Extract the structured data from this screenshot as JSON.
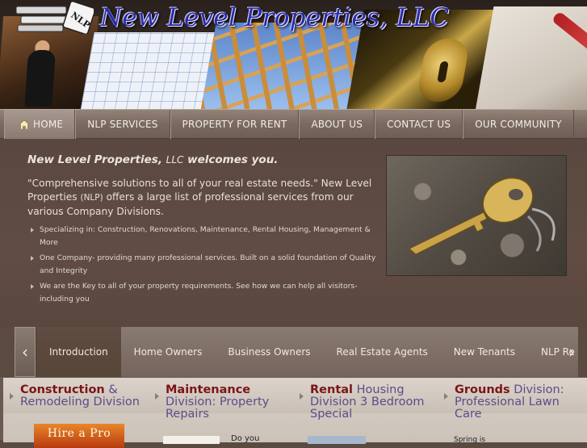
{
  "header": {
    "site_title": "New Level Properties, LLC",
    "logo_text": "NLP"
  },
  "nav": {
    "items": [
      {
        "label": "HOME",
        "icon": "home-icon"
      },
      {
        "label": "NLP SERVICES"
      },
      {
        "label": "PROPERTY FOR RENT"
      },
      {
        "label": "ABOUT US"
      },
      {
        "label": "CONTACT US"
      },
      {
        "label": "OUR COMMUNITY"
      }
    ]
  },
  "main": {
    "welcome_company": "New Level Properties,",
    "welcome_llc": "LLC",
    "welcome_tail": "welcomes you.",
    "intro_part1": "\"Comprehensive solutions to all of your real estate needs.\" New Level Properties",
    "intro_nlp": "(NLP)",
    "intro_part2": "offers a large list of professional services from our various Company Divisions.",
    "bullets": [
      "Specializing in: Construction, Renovations, Maintenance, Rental Housing, Management & More",
      "One Company- providing many professional services.  Built on a solid foundation of Quality and Integrity",
      "We are the Key to all of your property requirements.  See how we can help all visitors- including you"
    ]
  },
  "slider": {
    "prev_icon": "chevron-left-icon",
    "next_icon": "chevron-right-icon",
    "tabs": [
      "Introduction",
      "Home Owners",
      "Business Owners",
      "Real Estate Agents",
      "New Tenants",
      "NLP Re"
    ]
  },
  "columns": [
    {
      "strong": "Construction",
      "rest": " & Remodeling Division"
    },
    {
      "strong": "Maintenance",
      "rest": " Division: Property Repairs"
    },
    {
      "strong": "Rental",
      "rest": " Housing Division 3 Bedroom Special"
    },
    {
      "strong": "Grounds",
      "rest": " Division: Professional Lawn Care"
    }
  ],
  "column_extras": {
    "hire_badge": "Hire a Pro",
    "col2_text": "Do you",
    "col4_text": "Spring is"
  }
}
